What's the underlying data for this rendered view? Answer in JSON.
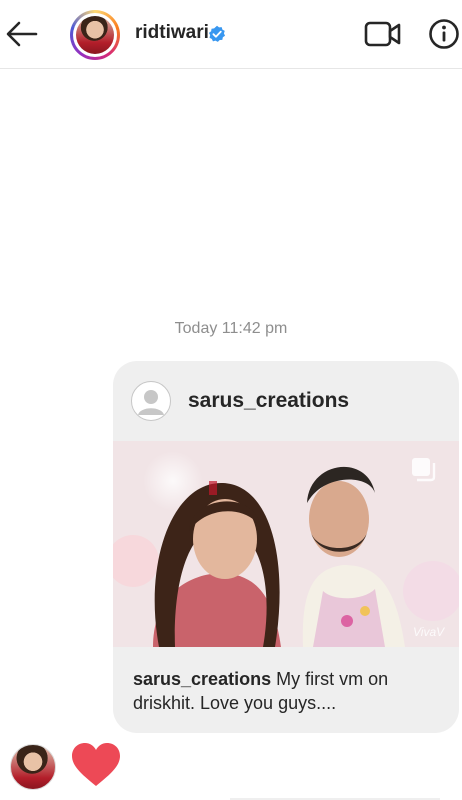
{
  "header": {
    "username": "ridtiwari",
    "icons": {
      "back": "back-arrow-icon",
      "verified": "verified-badge-icon",
      "video": "video-call-icon",
      "info": "info-icon"
    }
  },
  "conversation": {
    "timestamp": "Today 11:42 pm"
  },
  "shared_post": {
    "author": "sarus_creations",
    "caption_user": "sarus_creations",
    "caption_text": " My first vm on driskhit.  Love you guys....",
    "watermark": "VivaV"
  },
  "reaction": {
    "emoji": "heart-icon",
    "color": "#ed4956"
  },
  "colors": {
    "verified": "#3897f0",
    "heart": "#ed4956",
    "bubble": "#efefef",
    "muted_text": "#8e8e8e"
  }
}
